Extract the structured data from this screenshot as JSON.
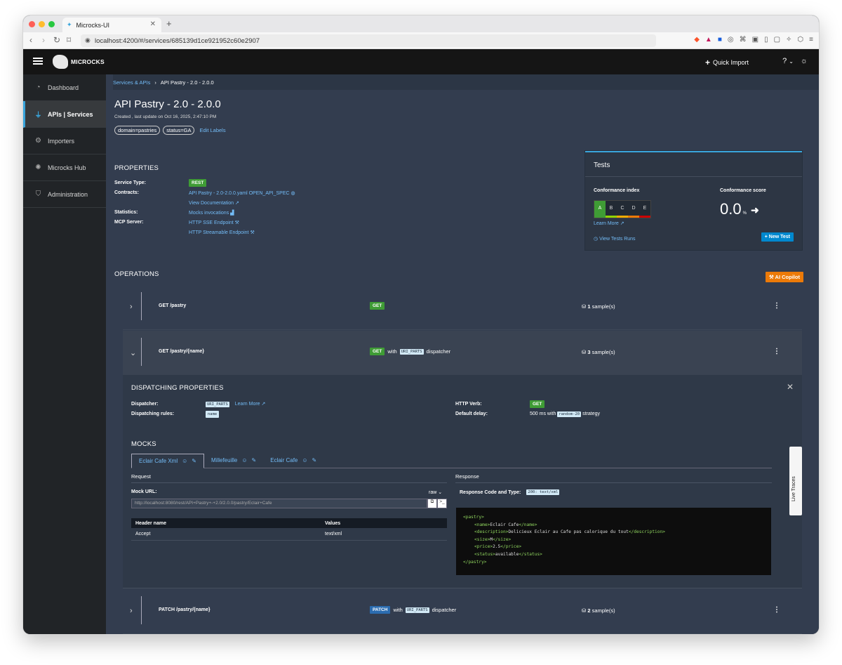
{
  "browser": {
    "tab_title": "Microcks-UI",
    "url": "localhost:4200/#/services/685139d1ce921952c60e2907"
  },
  "header": {
    "logo_text": "MICROCKS",
    "quick_import": "Quick Import",
    "help_caret": "⌄"
  },
  "sidebar": {
    "items": [
      {
        "label": "Dashboard",
        "icon": "dashboard-icon",
        "active": false
      },
      {
        "label": "APIs | Services",
        "icon": "plug-icon",
        "active": true
      },
      {
        "label": "Importers",
        "icon": "gears-icon",
        "active": false
      },
      {
        "label": "Microcks Hub",
        "icon": "hub-icon",
        "active": false
      },
      {
        "label": "Administration",
        "icon": "shield-icon",
        "active": false
      }
    ]
  },
  "breadcrumb": {
    "parent": "Services & APIs",
    "sep": "›",
    "current": "API Pastry - 2.0 - 2.0.0"
  },
  "service": {
    "title": "API Pastry - 2.0 - 2.0.0",
    "subtitle": "Created , last update on Oct 16, 2025, 2:47:10 PM",
    "labels": [
      "domain=pastries",
      "status=GA"
    ],
    "edit_labels": "Edit Labels"
  },
  "properties": {
    "title": "PROPERTIES",
    "service_type_key": "Service Type:",
    "service_type": "REST",
    "contracts_key": "Contracts:",
    "contract_link": "API Pastry - 2.0-2.0.0.yaml OPEN_API_SPEC",
    "view_docs": "View Documentation",
    "statistics_key": "Statistics:",
    "mocks_invocations": "Mocks invocations",
    "mcp_key": "MCP Server:",
    "sse_endpoint": "HTTP SSE Endpoint",
    "streamable_endpoint": "HTTP Streamable Endpoint"
  },
  "tests": {
    "title": "Tests",
    "conformance_index_label": "Conformance index",
    "grades": [
      "A",
      "B",
      "C",
      "D",
      "E"
    ],
    "active_grade": "A",
    "learn_more": "Learn More",
    "conformance_score_label": "Conformance score",
    "score": "0.0",
    "score_unit": "%",
    "view_runs": "View Tests Runs",
    "new_test": "+ New Test"
  },
  "operations": {
    "title": "OPERATIONS",
    "ai_copilot": "AI Copilot",
    "list": [
      {
        "name": "GET /pastry",
        "method": "GET",
        "with": "",
        "dispatcher": "",
        "suffix": "",
        "samples_count": "1",
        "samples_label": "sample(s)"
      },
      {
        "name": "GET /pastry/{name}",
        "method": "GET",
        "with": "with",
        "dispatcher": "URI_PARTS",
        "suffix": "dispatcher",
        "samples_count": "3",
        "samples_label": "sample(s)"
      },
      {
        "name": "PATCH /pastry/{name}",
        "method": "PATCH",
        "with": "with",
        "dispatcher": "URI_PARTS",
        "suffix": "dispatcher",
        "samples_count": "2",
        "samples_label": "sample(s)"
      }
    ]
  },
  "dispatching": {
    "title": "DISPATCHING PROPERTIES",
    "dispatcher_key": "Dispatcher:",
    "dispatcher": "URI_PARTS",
    "learn_more": "Learn More",
    "rules_key": "Dispatching rules:",
    "rules": "name",
    "verb_key": "HTTP Verb:",
    "verb": "GET",
    "delay_key": "Default delay:",
    "delay_prefix": "500 ms with",
    "delay_strategy": "random-20",
    "delay_suffix": "strategy"
  },
  "mocks": {
    "title": "MOCKS",
    "tabs": [
      "Eclair Cafe Xml",
      "Millefeuille",
      "Eclair Cafe"
    ],
    "request_label": "Request",
    "response_label": "Response",
    "mock_url_label": "Mock URL:",
    "raw_select": "raw",
    "mock_url": "http://localhost:8080/rest/API+Pastry+-+2.0/2.0.0/pastry/Eclair+Cafe",
    "headers_table": {
      "columns": [
        "Header name",
        "Values"
      ],
      "rows": [
        [
          "Accept",
          "text/xml"
        ]
      ]
    },
    "response_code_label": "Response Code and Type:",
    "response_code": "200: text/xml",
    "response_body": [
      {
        "indent": 0,
        "open": "<pastry>",
        "text": "",
        "close": ""
      },
      {
        "indent": 1,
        "open": "<name>",
        "text": "Eclair Cafe",
        "close": "</name>"
      },
      {
        "indent": 1,
        "open": "<description>",
        "text": "Delicieux Eclair au Cafe pas calorique du tout",
        "close": "</description>"
      },
      {
        "indent": 1,
        "open": "<size>",
        "text": "M",
        "close": "</size>"
      },
      {
        "indent": 1,
        "open": "<price>",
        "text": "2.5",
        "close": "</price>"
      },
      {
        "indent": 1,
        "open": "<status>",
        "text": "available",
        "close": "</status>"
      },
      {
        "indent": 0,
        "open": "</pastry>",
        "text": "",
        "close": ""
      }
    ]
  },
  "live_traces": "Live Traces",
  "colors": {
    "accent": "#39a5dc",
    "link": "#73bcf7",
    "get_badge": "#3f9c35",
    "patch_badge": "#2b6cb0",
    "copilot": "#ec7a08"
  }
}
